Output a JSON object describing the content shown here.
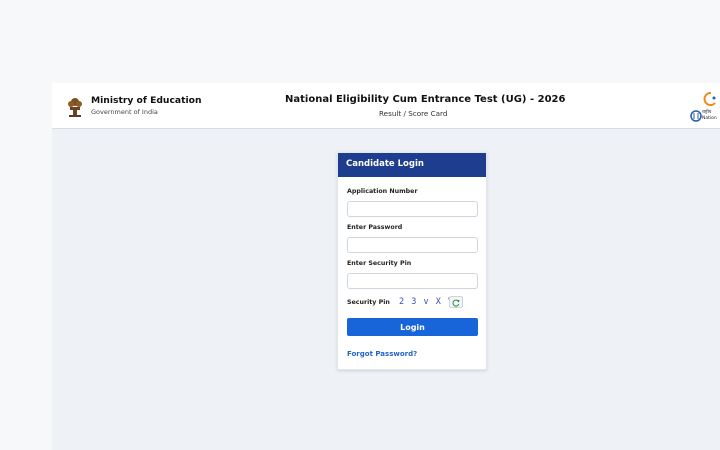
{
  "header": {
    "ministry_title": "Ministry of Education",
    "government": "Government of India",
    "exam_title": "National Eligibility Cum Entrance Test (UG) - 2026",
    "page_subtitle": "Result / Score Card",
    "agency_short": "राष्ट्रीय",
    "agency_name": "Nation"
  },
  "login": {
    "title": "Candidate Login",
    "application_number_label": "Application Number",
    "application_number_value": "",
    "password_label": "Enter Password",
    "password_value": "",
    "security_pin_label": "Enter Security Pin",
    "security_pin_value": "",
    "captcha_label": "Security Pin",
    "captcha_code": "2 3 v X V",
    "login_button": "Login",
    "forgot_password": "Forgot Password?"
  },
  "icons": {
    "emblem": "state-emblem-icon",
    "agency_logo": "nta-logo-icon",
    "refresh": "refresh-icon"
  },
  "colors": {
    "header_bar": "#1e3d8f",
    "button_primary": "#1765d8",
    "link": "#1f64c9",
    "background": "#eef1f5"
  }
}
